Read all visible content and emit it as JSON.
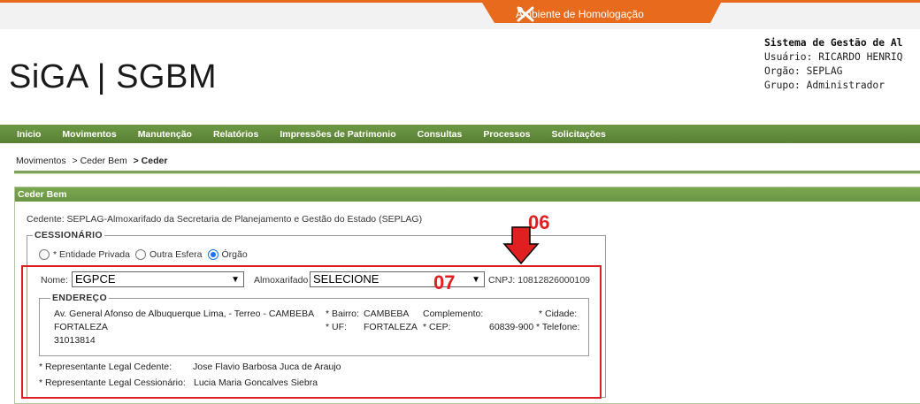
{
  "env": {
    "label": "Ambiente de Homologação",
    "icon": "tools-icon",
    "color": "#e86a1c"
  },
  "logo": {
    "text": "SiGA | SGBM"
  },
  "sysinfo": {
    "title": "Sistema de Gestão de Al",
    "usuario": "Usuário: RICARDO HENRIQ",
    "orgao": "Orgão: SEPLAG",
    "grupo": "Grupo: Administrador"
  },
  "nav": [
    "Inicio",
    "Movimentos",
    "Manutenção",
    "Relatórios",
    "Impressões de Patrimonio",
    "Consultas",
    "Processos",
    "Solicitações"
  ],
  "breadcrumb": {
    "a": "Movimentos",
    "b": "> Ceder Bem",
    "c": "> Ceder"
  },
  "panel": {
    "title": "Ceder Bem"
  },
  "cedente": "Cedente: SEPLAG-Almoxarifado da Secretaria de Planejamento e Gestão do Estado (SEPLAG)",
  "cessionario": {
    "legend": "CESSIONÁRIO",
    "radios": [
      {
        "label": "* Entidade Privada",
        "checked": false
      },
      {
        "label": "Outra Esfera",
        "checked": false
      },
      {
        "label": "Órgão",
        "checked": true
      }
    ],
    "nome_label": "Nome:",
    "nome_value": "EGPCE",
    "almox_label": "Almoxarifado",
    "almox_value": "SELECIONE",
    "cnpj": "CNPJ: 10812826000109"
  },
  "endereco": {
    "legend": "ENDEREÇO",
    "logradouro": "Av. General Afonso de Albuquerque Lima, - Terreo - CAMBEBA",
    "bairro": "* Bairro:",
    "bairro_value": "CAMBEBA",
    "complemento": "Complemento:",
    "cidade": "* Cidade:",
    "cidade_value": "FORTALEZA",
    "uf": "* UF:",
    "uf_value": "FORTALEZA",
    "cep": "* CEP:",
    "cep_value": "60839-900",
    "telefone": "* Telefone:",
    "telefone_value": "31013814"
  },
  "representantes": {
    "cedente_label": "* Representante Legal Cedente:",
    "cedente_value": "Jose Flavio Barbosa Juca de Araujo",
    "cessionario_label": "* Representante Legal Cessionário:",
    "cessionario_value": "Lucia Maria Goncalves Siebra"
  },
  "annotations": {
    "m06": "06",
    "m07": "07",
    "color": "#e02020"
  }
}
